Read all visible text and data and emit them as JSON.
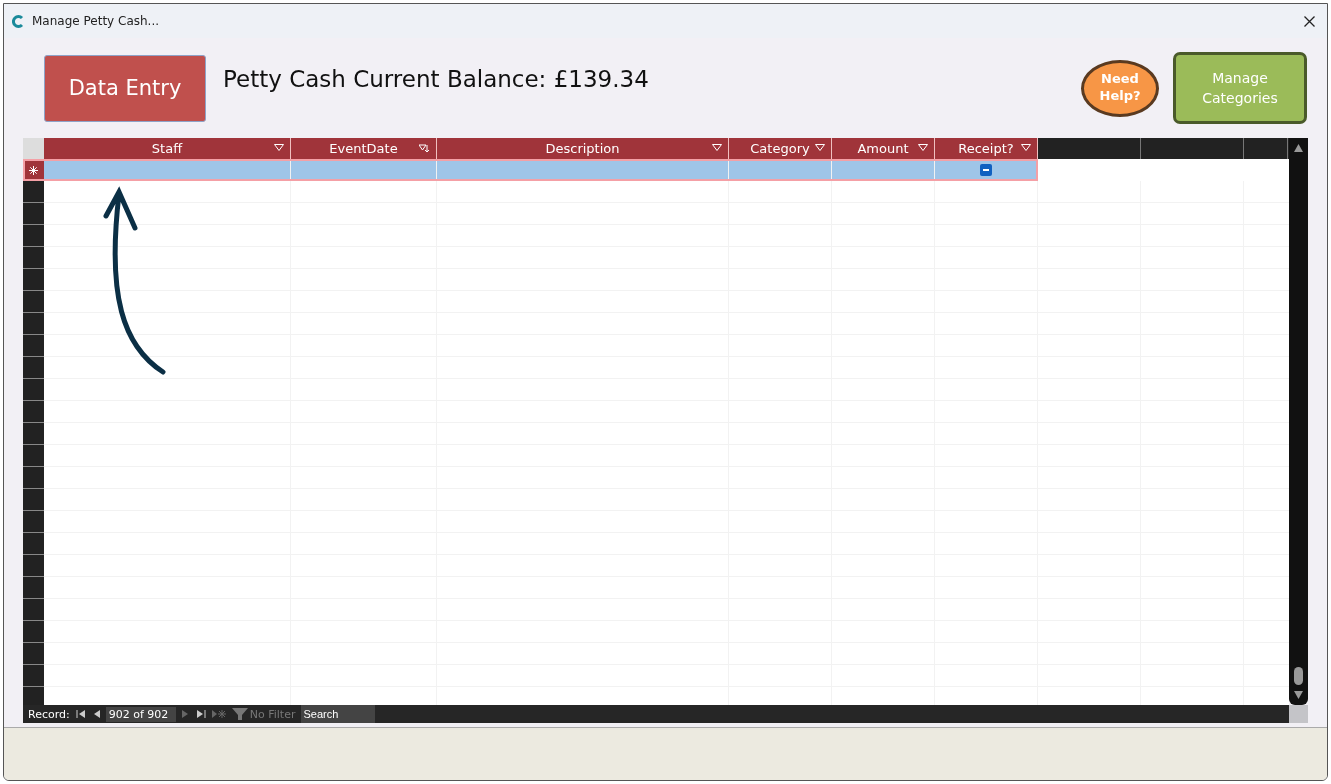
{
  "window": {
    "title": "Manage Petty Cash..."
  },
  "header": {
    "data_entry_button": "Data Entry",
    "balance": "Petty Cash Current Balance: £139.34",
    "help_button": "Need Help?",
    "manage_button": "Manage Categories"
  },
  "table": {
    "columns": [
      {
        "label": "Staff",
        "kind": "dropdown"
      },
      {
        "label": "EventDate",
        "kind": "filtered"
      },
      {
        "label": "Description",
        "kind": "dropdown"
      },
      {
        "label": "Category",
        "kind": "dropdown"
      },
      {
        "label": "Amount",
        "kind": "dropdown"
      },
      {
        "label": "Receipt?",
        "kind": "dropdown"
      }
    ],
    "new_row": {
      "selected": true,
      "receipt_indeterminate": true
    }
  },
  "navigation": {
    "label": "Record:",
    "position": "902 of 902",
    "filter": "No Filter",
    "search": {
      "placeholder": "Search"
    }
  }
}
